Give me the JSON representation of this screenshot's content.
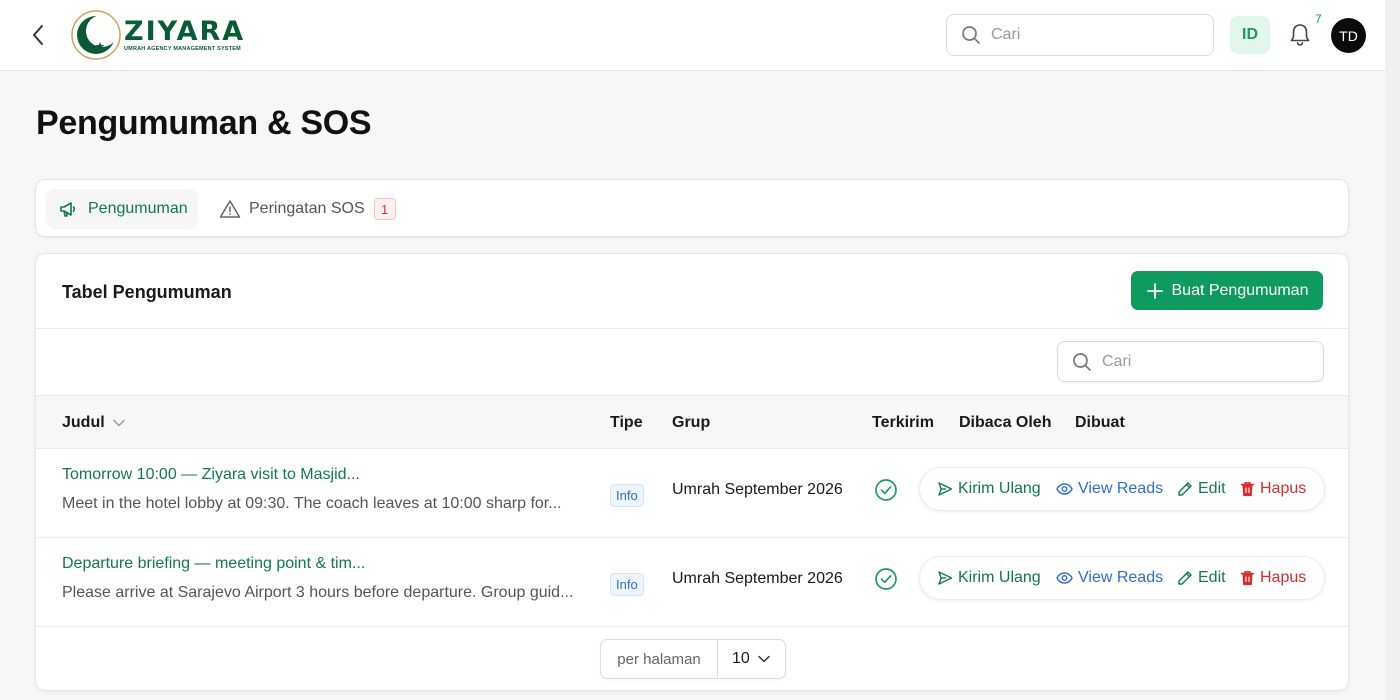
{
  "header": {
    "logo_name": "ZIYARA",
    "logo_sub": "UMRAH AGENCY MANAGEMENT SYSTEM",
    "search_placeholder": "Cari",
    "language": "ID",
    "notification_count": "7",
    "avatar_initials": "TD"
  },
  "page": {
    "title": "Pengumuman & SOS"
  },
  "tabs": [
    {
      "label": "Pengumuman",
      "icon": "megaphone-icon",
      "active": true
    },
    {
      "label": "Peringatan SOS",
      "icon": "warning-triangle-icon",
      "badge": "1"
    }
  ],
  "table_card": {
    "title": "Tabel Pengumuman",
    "create_label": "Buat Pengumuman",
    "search_placeholder": "Cari",
    "columns": [
      "Judul",
      "Tipe",
      "Grup",
      "Terkirim",
      "Dibaca Oleh",
      "Dibuat"
    ],
    "rows": [
      {
        "title": "Tomorrow 10:00 — Ziyara visit to Masjid...",
        "desc": "Meet in the hotel lobby at 09:30. The coach leaves at 10:00 sharp for...",
        "type": "Info",
        "group": "Umrah September 2026",
        "sent_icon": "check-circle-icon"
      },
      {
        "title": "Departure briefing — meeting point & tim...",
        "desc": "Please arrive at Sarajevo Airport 3 hours before departure. Group guid...",
        "type": "Info",
        "group": "Umrah September 2026",
        "sent_icon": "check-circle-icon"
      }
    ],
    "actions": {
      "resend": "Kirim Ulang",
      "view_reads": "View Reads",
      "edit": "Edit",
      "delete": "Hapus"
    },
    "pagination": {
      "per_page_label": "per halaman",
      "per_page_value": "10"
    }
  },
  "colors": {
    "brand": "#0f9a5f",
    "link_green": "#117a4d",
    "link_blue": "#2f6ecb",
    "danger": "#d32f2f"
  }
}
